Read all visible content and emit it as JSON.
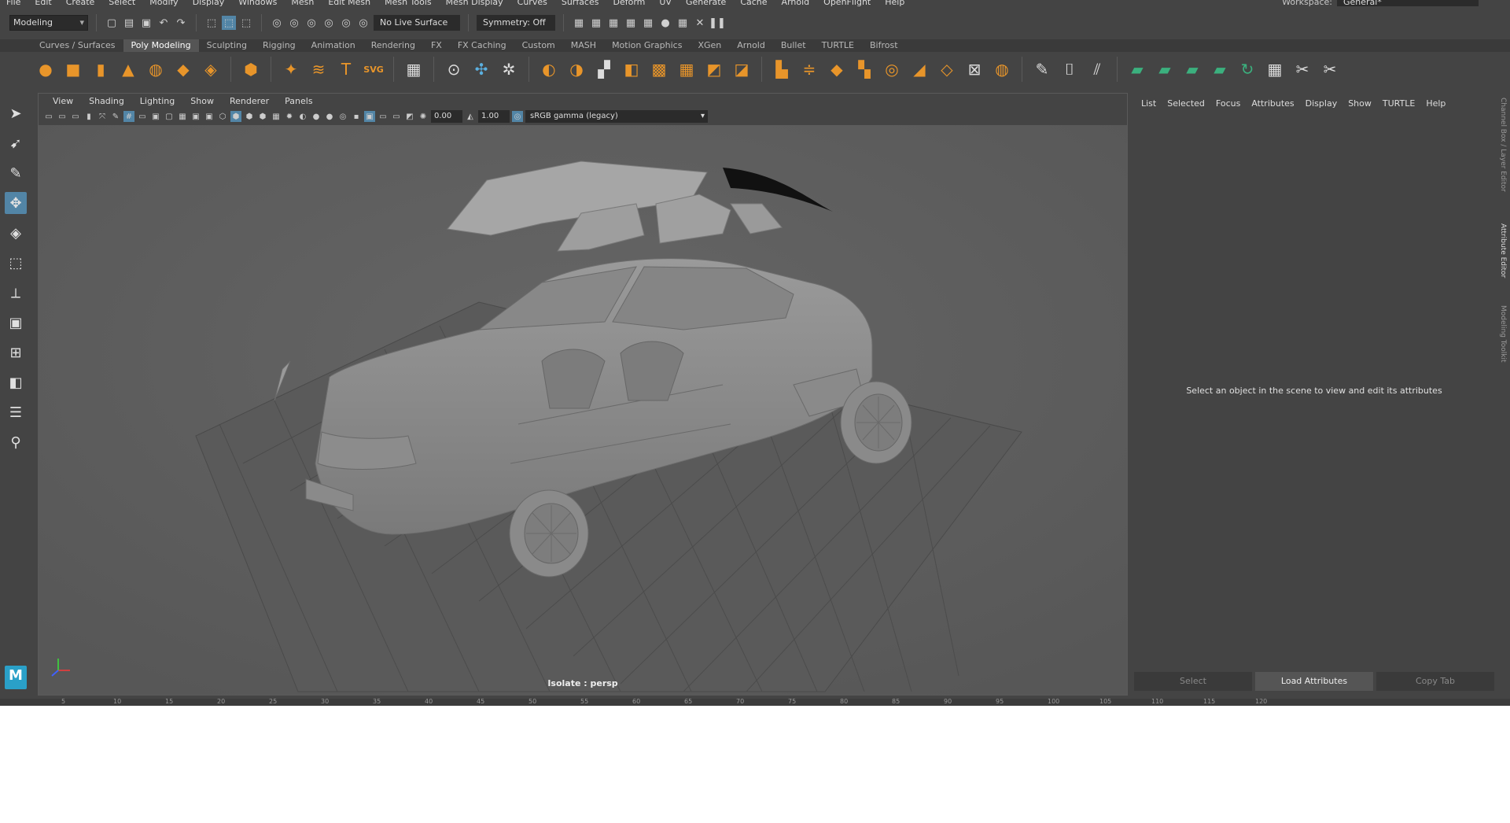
{
  "menu": [
    "File",
    "Edit",
    "Create",
    "Select",
    "Modify",
    "Display",
    "Windows",
    "Mesh",
    "Edit Mesh",
    "Mesh Tools",
    "Mesh Display",
    "Curves",
    "Surfaces",
    "Deform",
    "UV",
    "Generate",
    "Cache",
    "Arnold",
    "OpenFlight",
    "Help"
  ],
  "workspace": {
    "label": "Workspace:",
    "value": "General*"
  },
  "status": {
    "mode": "Modeling",
    "live_surface": "No Live Surface",
    "symmetry": "Symmetry: Off"
  },
  "shelf_tabs": [
    "Curves / Surfaces",
    "Poly Modeling",
    "Sculpting",
    "Rigging",
    "Animation",
    "Rendering",
    "FX",
    "FX Caching",
    "Custom",
    "MASH",
    "Motion Graphics",
    "XGen",
    "Arnold",
    "Bullet",
    "TURTLE",
    "Bifrost"
  ],
  "shelf_active": "Poly Modeling",
  "viewport": {
    "menu": [
      "View",
      "Shading",
      "Lighting",
      "Show",
      "Renderer",
      "Panels"
    ],
    "exposure": "0.00",
    "gamma_value": "1.00",
    "color_space": "sRGB gamma (legacy)",
    "camera_label": "Isolate : persp"
  },
  "attr_editor": {
    "menu": [
      "List",
      "Selected",
      "Focus",
      "Attributes",
      "Display",
      "Show",
      "TURTLE",
      "Help"
    ],
    "message": "Select an object in the scene to view and edit its attributes",
    "buttons": [
      "Select",
      "Load Attributes",
      "Copy Tab"
    ]
  },
  "side_tabs": [
    "Channel Box / Layer Editor",
    "Attribute Editor",
    "Modeling Toolkit"
  ],
  "timeline_ticks": [
    "5",
    "10",
    "15",
    "20",
    "25",
    "30",
    "35",
    "40",
    "45",
    "50",
    "55",
    "60",
    "65",
    "70",
    "75",
    "80",
    "85",
    "90",
    "95",
    "100",
    "105",
    "110",
    "115",
    "120"
  ],
  "logo": "M"
}
